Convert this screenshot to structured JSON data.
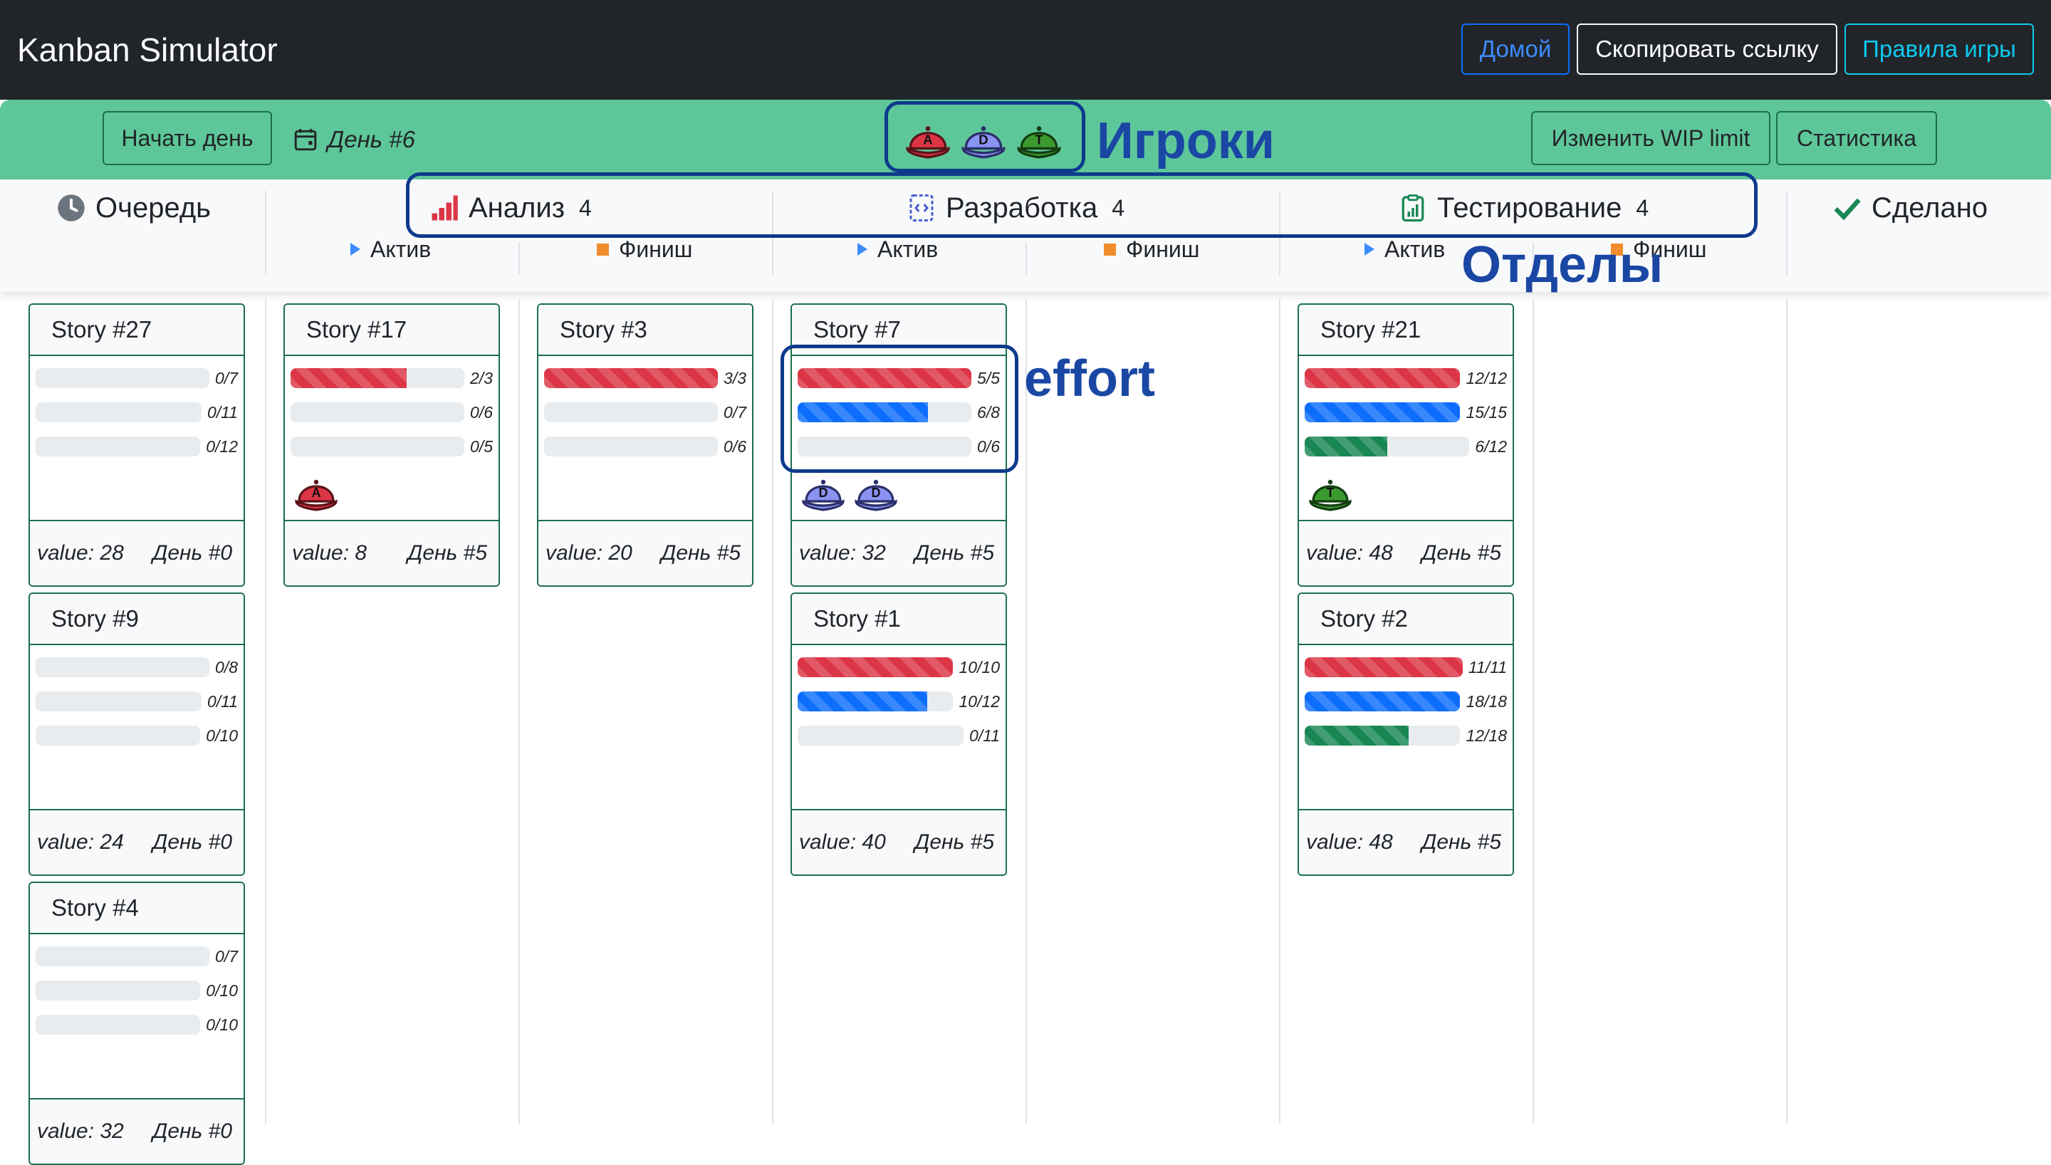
{
  "navbar": {
    "brand": "Kanban Simulator",
    "home_label": "Домой",
    "copy_label": "Скопировать ссылку",
    "rules_label": "Правила игры"
  },
  "toolbar": {
    "start_day_label": "Начать день",
    "day_label": "День #6",
    "players": [
      "A",
      "D",
      "T"
    ],
    "wip_label": "Изменить WIP limit",
    "stats_label": "Статистика"
  },
  "columns": {
    "queue": "Очередь",
    "analysis": {
      "title": "Анализ",
      "count": "4"
    },
    "development": {
      "title": "Разработка",
      "count": "4"
    },
    "testing": {
      "title": "Тестирование",
      "count": "4"
    },
    "done": "Сделано",
    "sub_active": "Актив",
    "sub_finish": "Финиш"
  },
  "annotations": {
    "players": "Игроки",
    "departments": "Отделы",
    "effort": "effort"
  },
  "colors": {
    "analysis": "#dc3545",
    "development": "#0d6efd",
    "testing": "#198754",
    "toolbar": "#5ec79a",
    "navbar": "#212529",
    "annotation": "#1a47a4"
  },
  "stories": [
    {
      "title": "Story #27",
      "value": "value: 28",
      "day": "День #0",
      "bars": [
        {
          "label": "0/7",
          "pct": 0
        },
        {
          "label": "0/11",
          "pct": 0
        },
        {
          "label": "0/12",
          "pct": 0
        }
      ],
      "players": []
    },
    {
      "title": "Story #9",
      "value": "value: 24",
      "day": "День #0",
      "bars": [
        {
          "label": "0/8",
          "pct": 0
        },
        {
          "label": "0/11",
          "pct": 0
        },
        {
          "label": "0/10",
          "pct": 0
        }
      ],
      "players": []
    },
    {
      "title": "Story #4",
      "value": "value: 32",
      "day": "День #0",
      "bars": [
        {
          "label": "0/7",
          "pct": 0
        },
        {
          "label": "0/10",
          "pct": 0
        },
        {
          "label": "0/10",
          "pct": 0
        }
      ],
      "players": []
    },
    {
      "title": "Story #17",
      "value": "value: 8",
      "day": "День #5",
      "bars": [
        {
          "label": "2/3",
          "pct": 66.7
        },
        {
          "label": "0/6",
          "pct": 0
        },
        {
          "label": "0/5",
          "pct": 0
        }
      ],
      "players": [
        "A"
      ]
    },
    {
      "title": "Story #3",
      "value": "value: 20",
      "day": "День #5",
      "bars": [
        {
          "label": "3/3",
          "pct": 100
        },
        {
          "label": "0/7",
          "pct": 0
        },
        {
          "label": "0/6",
          "pct": 0
        }
      ],
      "players": []
    },
    {
      "title": "Story #7",
      "value": "value: 32",
      "day": "День #5",
      "bars": [
        {
          "label": "5/5",
          "pct": 100
        },
        {
          "label": "6/8",
          "pct": 75
        },
        {
          "label": "0/6",
          "pct": 0
        }
      ],
      "players": [
        "D",
        "D"
      ]
    },
    {
      "title": "Story #1",
      "value": "value: 40",
      "day": "День #5",
      "bars": [
        {
          "label": "10/10",
          "pct": 100
        },
        {
          "label": "10/12",
          "pct": 83.3
        },
        {
          "label": "0/11",
          "pct": 0
        }
      ],
      "players": []
    },
    {
      "title": "Story #21",
      "value": "value: 48",
      "day": "День #5",
      "bars": [
        {
          "label": "12/12",
          "pct": 100
        },
        {
          "label": "15/15",
          "pct": 100
        },
        {
          "label": "6/12",
          "pct": 50
        }
      ],
      "players": [
        "T"
      ]
    },
    {
      "title": "Story #2",
      "value": "value: 48",
      "day": "День #5",
      "bars": [
        {
          "label": "11/11",
          "pct": 100
        },
        {
          "label": "18/18",
          "pct": 100
        },
        {
          "label": "12/18",
          "pct": 66.7
        }
      ],
      "players": []
    }
  ]
}
